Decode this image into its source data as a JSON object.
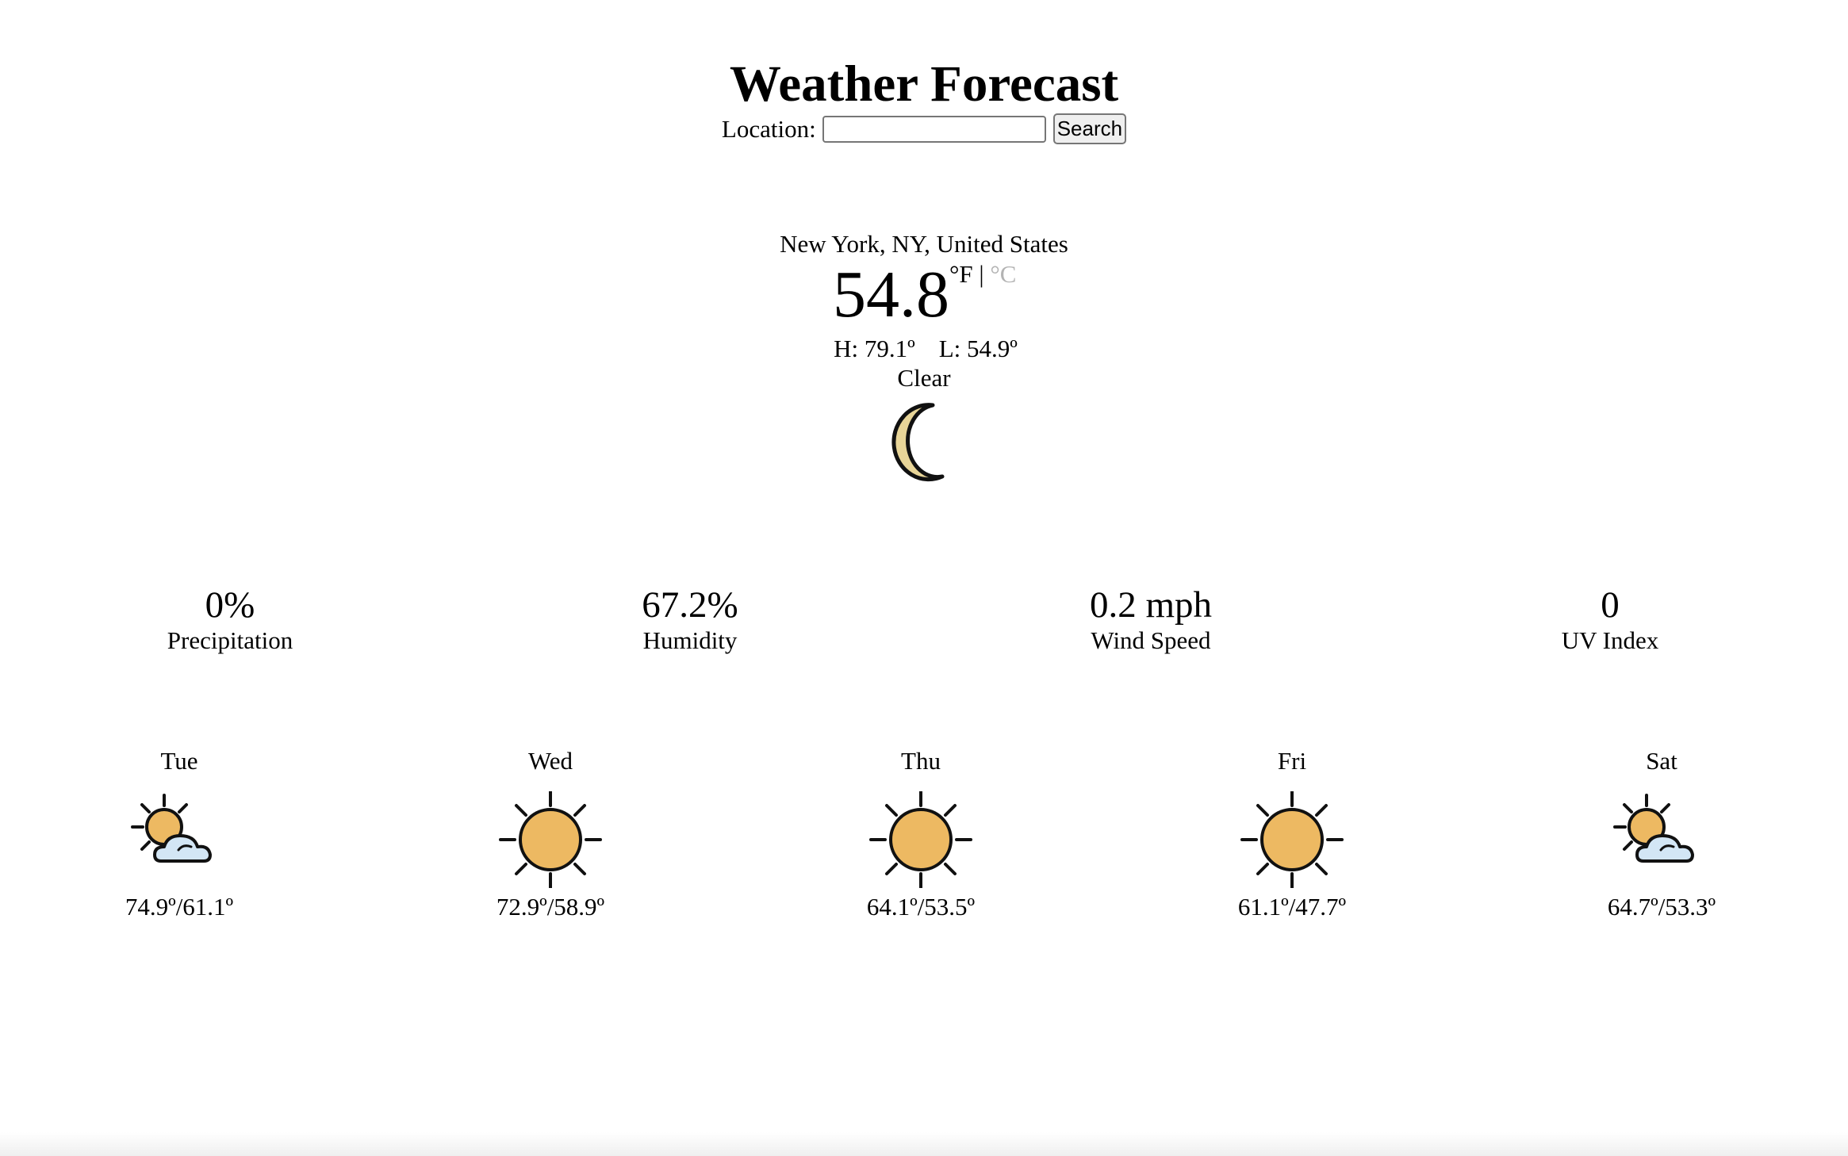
{
  "header": {
    "title": "Weather Forecast",
    "location_label": "Location:",
    "search_placeholder": "",
    "search_value": "",
    "search_button": "Search"
  },
  "current": {
    "location": "New York, NY, United States",
    "temperature": "54.8",
    "unit_f": "°F",
    "unit_separator": "|",
    "unit_c": "°C",
    "high": "H: 79.1º",
    "low": "L: 54.9º",
    "condition": "Clear",
    "icon": "crescent-moon-icon"
  },
  "stats": [
    {
      "value": "0%",
      "label": "Precipitation"
    },
    {
      "value": "67.2%",
      "label": "Humidity"
    },
    {
      "value": "0.2 mph",
      "label": "Wind Speed"
    },
    {
      "value": "0",
      "label": "UV Index"
    }
  ],
  "forecast": [
    {
      "day": "Tue",
      "icon": "partly-cloudy-icon",
      "temps": "74.9º/61.1º"
    },
    {
      "day": "Wed",
      "icon": "sun-icon",
      "temps": "72.9º/58.9º"
    },
    {
      "day": "Thu",
      "icon": "sun-icon",
      "temps": "64.1º/53.5º"
    },
    {
      "day": "Fri",
      "icon": "sun-icon",
      "temps": "61.1º/47.7º"
    },
    {
      "day": "Sat",
      "icon": "partly-cloudy-icon",
      "temps": "64.7º/53.3º"
    }
  ],
  "colors": {
    "sun": "#EDB962",
    "moon": "#E8D598",
    "cloud": "#D3E6F5",
    "outline": "#111111",
    "inactive_unit": "#B3B3B3"
  }
}
